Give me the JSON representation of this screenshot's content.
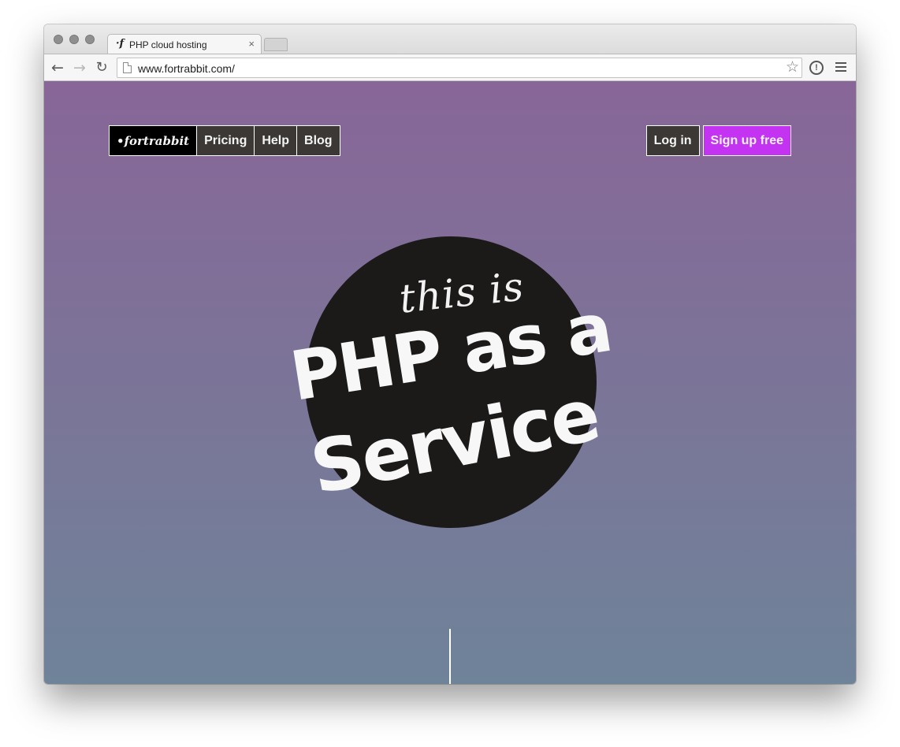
{
  "browser": {
    "tab": {
      "title": "PHP cloud hosting",
      "favicon": "·f",
      "close_glyph": "×"
    },
    "nav": {
      "back_icon": "←",
      "forward_icon": "→",
      "reload_icon": "↻"
    },
    "address_bar": {
      "url": "www.fortrabbit.com/",
      "star_icon": "☆"
    },
    "extension_icon": "!"
  },
  "site": {
    "nav_left": {
      "logo": "•fortrabbit",
      "items": [
        "Pricing",
        "Help",
        "Blog"
      ]
    },
    "nav_right": {
      "login": "Log in",
      "signup": "Sign up free"
    },
    "hero": {
      "small_text": "this is",
      "line1": "PHP as a",
      "line2": "Service"
    },
    "colors": {
      "gradient_top": "#886698",
      "gradient_bottom": "#6f8399",
      "badge": "#1c1a19",
      "signup_accent": "#c432f2",
      "nav_item_bg": "#3b3835"
    }
  }
}
